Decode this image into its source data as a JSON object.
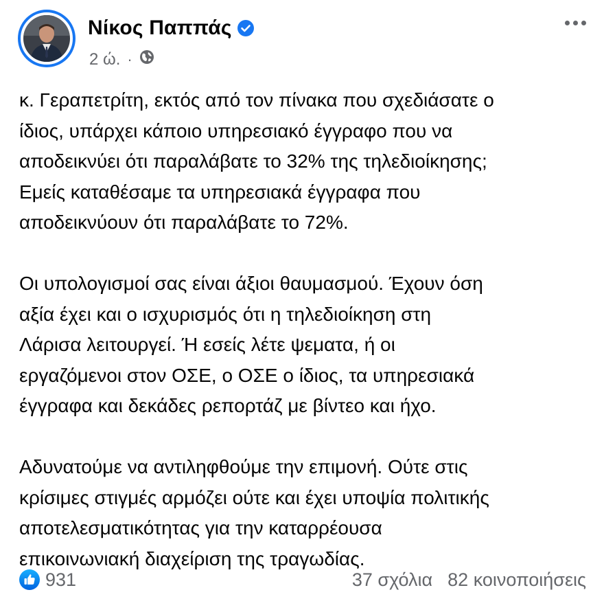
{
  "post": {
    "author": {
      "name": "Νίκος Παππάς",
      "verified": true
    },
    "meta": {
      "time": "2 ώ.",
      "separator": "·",
      "audience_icon": "globe-icon"
    },
    "more_icon": "more-options-icon",
    "paragraphs": [
      [
        "κ. Γεραπετρίτη, εκτός από τον πίνακα που σχεδιάσατε ο",
        "ίδιος, υπάρχει κάποιο υπηρεσιακό έγγραφο που να",
        "αποδεικνύει ότι παραλάβατε το 32% της τηλεδιοίκησης;",
        "Εμείς καταθέσαμε τα υπηρεσιακά έγγραφα που",
        "αποδεικνύουν ότι παραλάβατε το 72%."
      ],
      [
        "Οι υπολογισμοί σας είναι άξιοι θαυμασμού. Έχουν όση",
        "αξία έχει και ο ισχυρισμός ότι η τηλεδιοίκηση στη",
        "Λάρισα λειτουργεί. Ή εσείς λέτε ψεματα, ή οι",
        "εργαζόμενοι στον ΟΣΕ, ο ΟΣΕ ο ίδιος, τα υπηρεσιακά",
        "έγγραφα και δεκάδες ρεπορτάζ με βίντεο και ήχο."
      ],
      [
        "Αδυνατούμε να αντιληφθούμε την επιμονή. Ούτε στις",
        "κρίσιμες στιγμές αρμόζει ούτε και έχει υποψία πολιτικής",
        "αποτελεσματικότητας για την καταρρέουσα",
        "επικοινωνιακή διαχείριση της τραγωδίας."
      ]
    ],
    "footer": {
      "like_icon": "like-icon",
      "reaction_count": "931",
      "comments": "37 σχόλια",
      "shares": "82 κοινοποιήσεις"
    },
    "colors": {
      "accent": "#1877f2",
      "meta_text": "#65676b",
      "body_text": "#050505"
    }
  }
}
